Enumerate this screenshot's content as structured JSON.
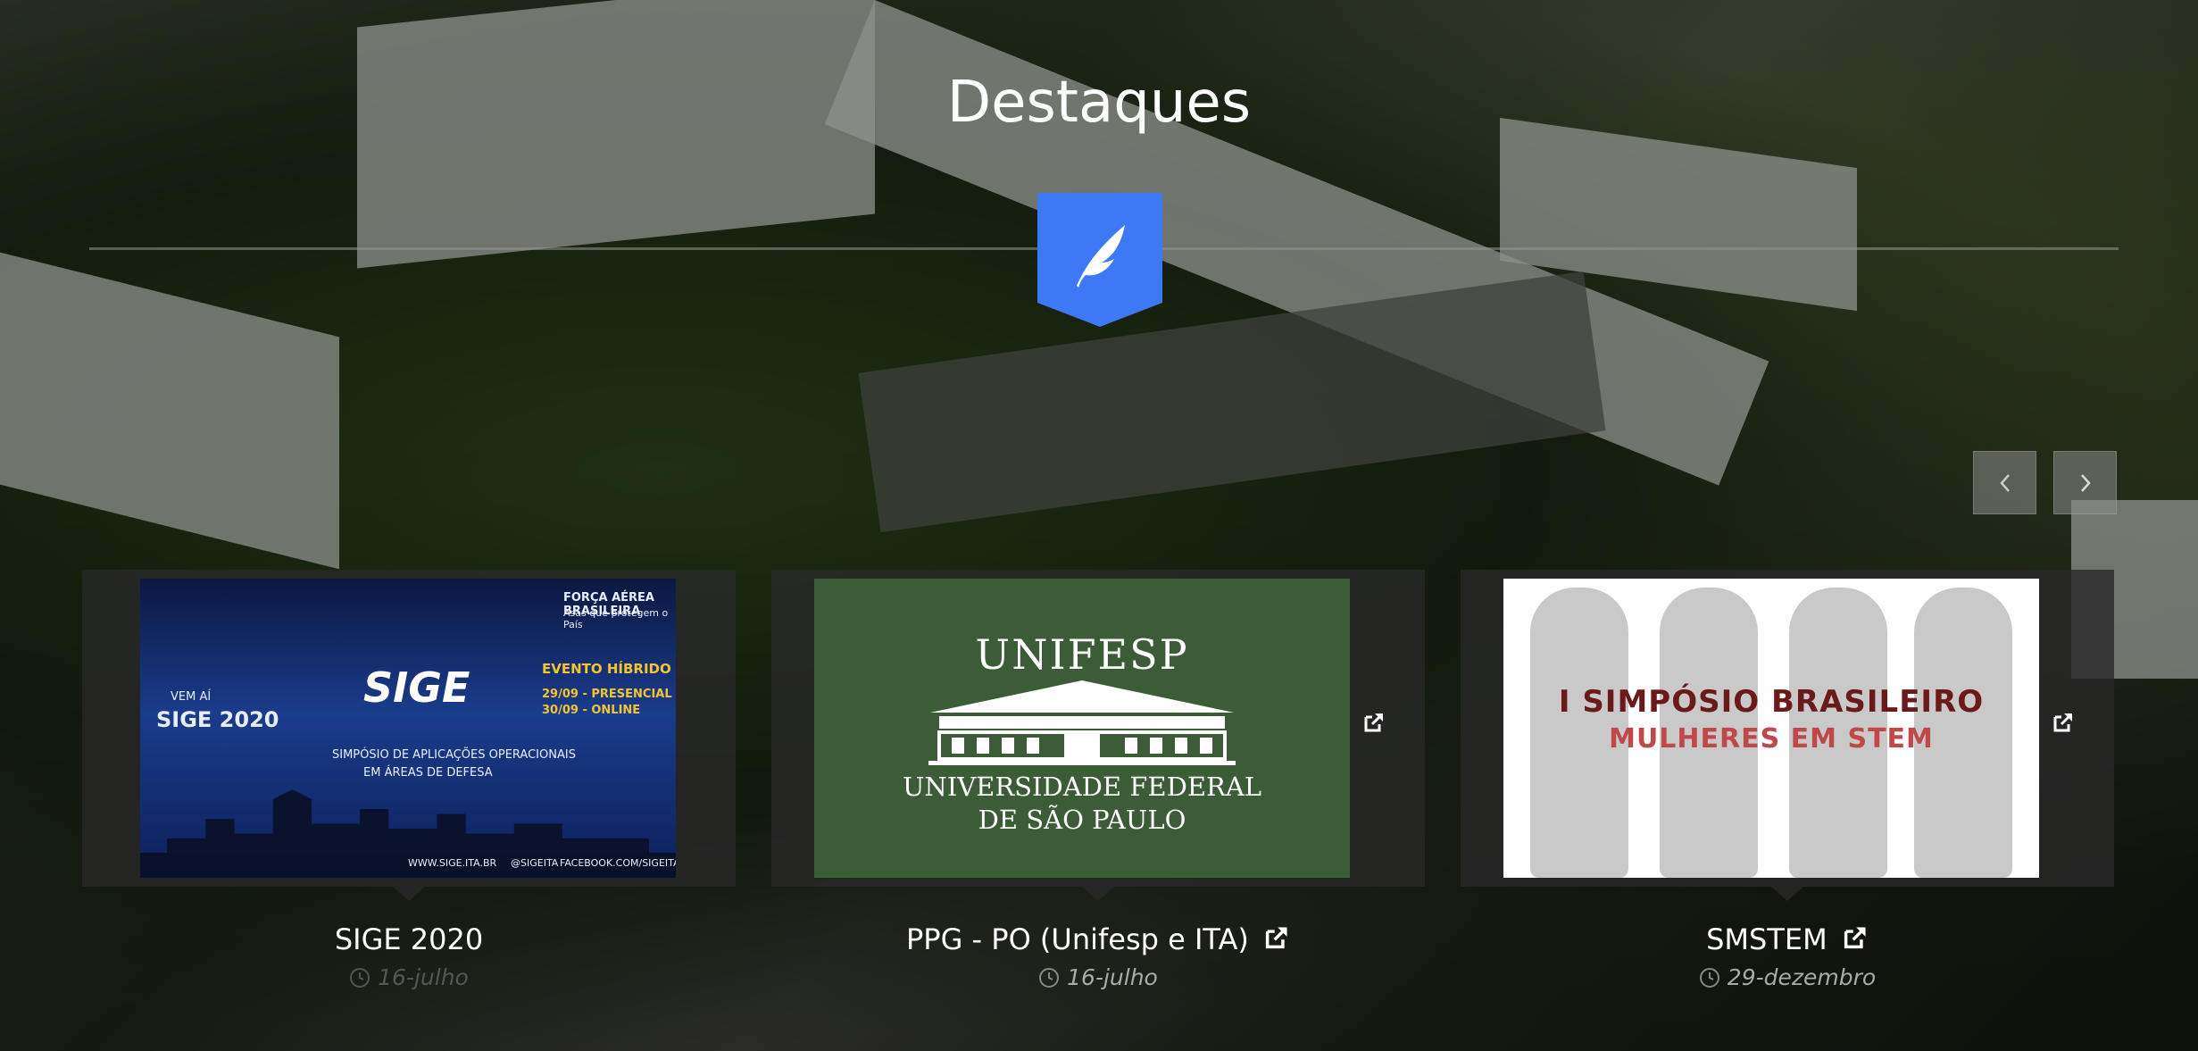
{
  "section": {
    "title": "Destaques"
  },
  "icons": {
    "badge": "quill-feather-icon",
    "prev": "chevron-left-icon",
    "next": "chevron-right-icon",
    "external": "external-link-icon",
    "clock": "clock-icon"
  },
  "colors": {
    "badge": "#3d78f5",
    "unifesp_bg": "#3b5d36",
    "sige_bg": "#1a3c8c"
  },
  "cards": [
    {
      "title": "SIGE 2020",
      "date": "16-julho",
      "external": false,
      "image": {
        "brand": "FORÇA AÉREA BRASILEIRA",
        "tagline": "Asas que protegem o País",
        "headline": "VEM AÍ",
        "event": "SIGE 2020",
        "logo": "SIGE",
        "subtitle_1": "SIMPÓSIO DE APLICAÇÕES OPERACIONAIS",
        "subtitle_2": "EM ÁREAS DE DEFESA",
        "mode": "EVENTO HÍBRIDO",
        "date_1": "29/09 - PRESENCIAL",
        "date_2": "30/09 - ONLINE",
        "footer_1": "WWW.SIGE.ITA.BR",
        "footer_2": "@SIGEITA",
        "footer_3": "FACEBOOK.COM/SIGEITA"
      }
    },
    {
      "title": "PPG - PO (Unifesp e ITA)",
      "date": "16-julho",
      "external": true,
      "image": {
        "name": "UNIFESP",
        "line_1": "UNIVERSIDADE FEDERAL",
        "line_2": "DE SÃO PAULO"
      }
    },
    {
      "title": "SMSTEM",
      "date": "29-dezembro",
      "external": true,
      "image": {
        "line_1": "I SIMPÓSIO BRASILEIRO",
        "line_2": "MULHERES EM STEM"
      }
    }
  ]
}
